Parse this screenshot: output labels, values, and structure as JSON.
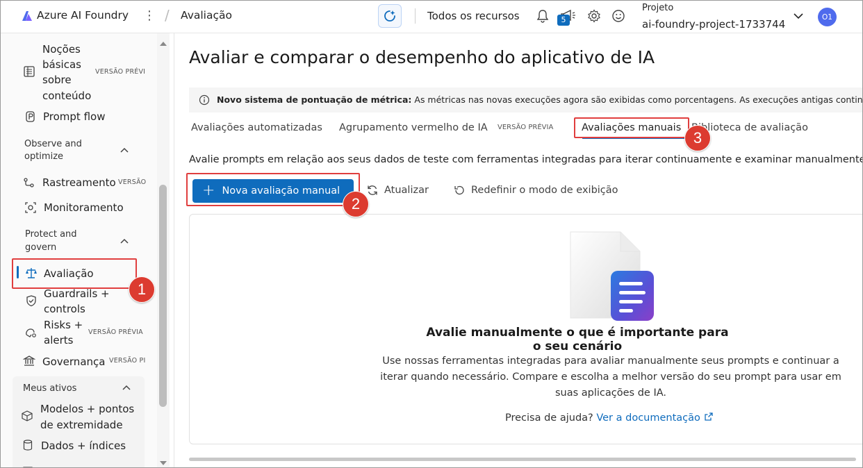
{
  "topbar": {
    "brand": "Azure AI Foundry",
    "breadcrumb": "Avaliação",
    "all_resources": "Todos os recursos",
    "notification_count": "5",
    "project_label": "Projeto",
    "project_name": "ai-foundry-project-1733744",
    "avatar_initials": "O1"
  },
  "sidebar": {
    "items": [
      {
        "label_lines": [
          "Noções",
          "básicas",
          "sobre",
          "conteúdo"
        ],
        "badge": "VERSÃO PRÉVI",
        "icon": "list-icon"
      },
      {
        "label": "Prompt flow",
        "icon": "flow-icon"
      },
      {
        "group": [
          "Observe and",
          "optimize"
        ]
      },
      {
        "label": "Rastreamento",
        "badge": "VERSÃO",
        "icon": "tracing-icon"
      },
      {
        "label": "Monitoramento",
        "icon": "monitor-icon"
      },
      {
        "group": [
          "Protect and",
          "govern"
        ]
      },
      {
        "label": "Avaliação",
        "icon": "scale-icon",
        "active": true
      },
      {
        "label_lines": [
          "Guardrails +",
          "controls"
        ],
        "icon": "shield-icon"
      },
      {
        "label_lines": [
          "Risks +",
          "alerts"
        ],
        "badge": "VERSÃO PRÉVIA",
        "icon": "risk-icon"
      },
      {
        "label": "Governança",
        "badge": "VERSÃO PI",
        "icon": "governance-icon"
      },
      {
        "group": [
          "Meus ativos"
        ]
      },
      {
        "label_lines": [
          "Modelos + pontos",
          "de extremidade"
        ],
        "icon": "cube-icon"
      },
      {
        "label": "Dados + índices",
        "icon": "database-icon"
      }
    ]
  },
  "main": {
    "title": "Avaliar e comparar o desempenho do aplicativo de IA",
    "info_bold": "Novo sistema de pontuação de métrica:",
    "info_text": " As métricas nas novas execuções agora são exibidas como porcentagens. As execuções antigas continuar",
    "tabs": [
      {
        "label": "Avaliações automatizadas"
      },
      {
        "label": "Agrupamento vermelho de IA",
        "badge": "VERSÃO PRÉVIA"
      },
      {
        "label": "Avaliações manuais",
        "selected": true
      },
      {
        "label": "Biblioteca de avaliação"
      }
    ],
    "description": "Avalie prompts em relação aos seus dados de teste com ferramentas integradas para iterar continuamente e examinar manualmente",
    "new_button": "Nova avaliação manual",
    "refresh": "Atualizar",
    "reset_view": "Redefinir o modo de exibição",
    "empty_title": "Avalie manualmente o que é importante para o seu cenário",
    "empty_body": "Use nossas ferramentas integradas para avaliar manualmente seus prompts e continuar a iterar quando necessário. Compare e escolha a melhor versão do seu prompt para usar em suas aplicações de IA.",
    "help_text": "Precisa de ajuda?",
    "help_link": "Ver a documentação"
  },
  "annotations": [
    "1",
    "2",
    "3"
  ],
  "colors": {
    "accent": "#0f6cbd",
    "highlight": "#e03e3e",
    "marker": "#dc3b30"
  }
}
